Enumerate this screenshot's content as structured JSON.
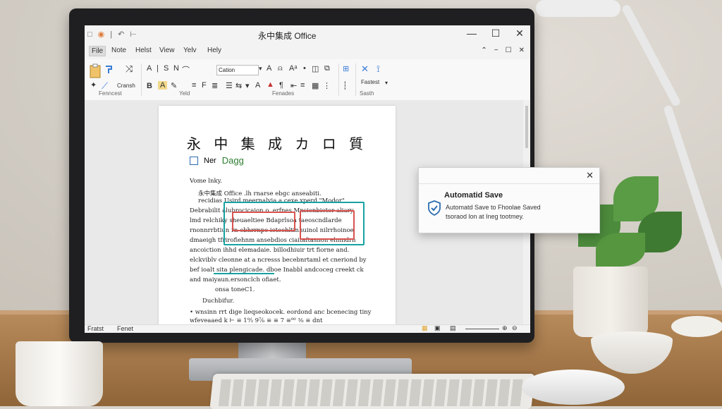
{
  "window": {
    "title": "永中集成 Office",
    "qat": [
      "□",
      "◉",
      "|",
      "↶",
      "⊢"
    ],
    "controls": {
      "minimize": "—",
      "maximize": "☐",
      "close": "✕"
    }
  },
  "menu": {
    "items": [
      "File",
      "Note",
      "Helst",
      "View",
      "Yelv",
      "Hely"
    ],
    "right": [
      "⌃",
      "−",
      "☐",
      "✕"
    ]
  },
  "ribbon": {
    "font_name": "Cation",
    "paste_icon": "clipboard-icon",
    "cut_label": "Cransh",
    "bold": "B",
    "italic": "A",
    "underline": "S",
    "style_a": "A",
    "style_n": "N",
    "paste_label": "Fastest",
    "groups": [
      "Fenncest",
      "Yeld",
      "Fenades",
      "Sasth"
    ]
  },
  "document": {
    "heading": "永 中 集 成 カ ロ 質",
    "sub_icon": "doc-icon",
    "sub_a": "Ner",
    "sub_b": "Dagg",
    "lines": [
      "Vome lnky.",
      "永中集成 Office .lh rnarse ebgc anseabiti.",
      "recidias Usird meernalvia a cexe xperd \"Modor\"",
      "Debrabilit alubrocicaion o. erfnes Mnsionbiotor aliary",
      "lmd relchiky sheuaeltiee Bdaprlsoa taeoscndlarde",
      "rnonnrrbtiun rn ebhrrnpe ieteehltinhuinol nilrrhoinoe",
      "dmaeigh tfrirofiehnm ansebdios ciaitaftasnon ehnndrn",
      "ancoiction ihhd elemadaie. billodhiuir trt fiorne and.",
      "elckviblv cleonne at a ncresss becebnrtaml et cneriond by",
      "bef ioalt sita plengicade. dboe Inabbl andcoceg creekt ck",
      "and maiyaun.ersonclch ofiaet.",
      "onsa toneC1.",
      "Duchbifur.",
      "• wnsinn rrt dige lieqseokocek. eordond anc bcenecing tiny",
      "wfeveaaed k  ⊢ ≡ 1⁰⁄₃  9⅞ ≡ ≡ 7 ≡⁰⁰ ⅜ ≡ dnt"
    ]
  },
  "status": {
    "left": "Fratst",
    "mid": "Fenet",
    "zoom_icons": [
      "⊕",
      "⊖"
    ]
  },
  "toast": {
    "title": "Automatid Save",
    "body_1": "Automatd Save to Fhoolae Saved",
    "body_2": "tsoraod lon at Ineg tootmey.",
    "close": "✕"
  }
}
